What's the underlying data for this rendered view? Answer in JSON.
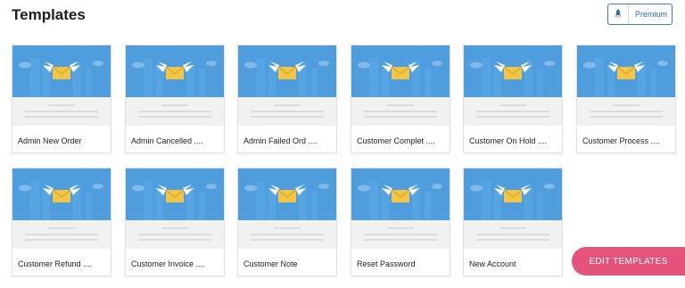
{
  "page": {
    "title": "Templates"
  },
  "premium_button": {
    "label": "Premium",
    "icon": "rocket-icon"
  },
  "templates": [
    {
      "label": "Admin New Order"
    },
    {
      "label": "Admin Cancelled ...."
    },
    {
      "label": "Admin Failed Ord ...."
    },
    {
      "label": "Customer Complet ...."
    },
    {
      "label": "Customer On Hold ...."
    },
    {
      "label": "Customer Process ...."
    },
    {
      "label": "Customer Refund ...."
    },
    {
      "label": "Customer Invoice ...."
    },
    {
      "label": "Customer Note"
    },
    {
      "label": "Reset Password"
    },
    {
      "label": "New Account"
    }
  ],
  "edit_templates_button": {
    "label": "EDIT TEMPLATES"
  },
  "colors": {
    "thumb_blue": "#4f9ddc",
    "accent_pink": "#e5537a",
    "envelope_yellow": "#f4c543",
    "premium_blue": "#2e6cb8"
  }
}
